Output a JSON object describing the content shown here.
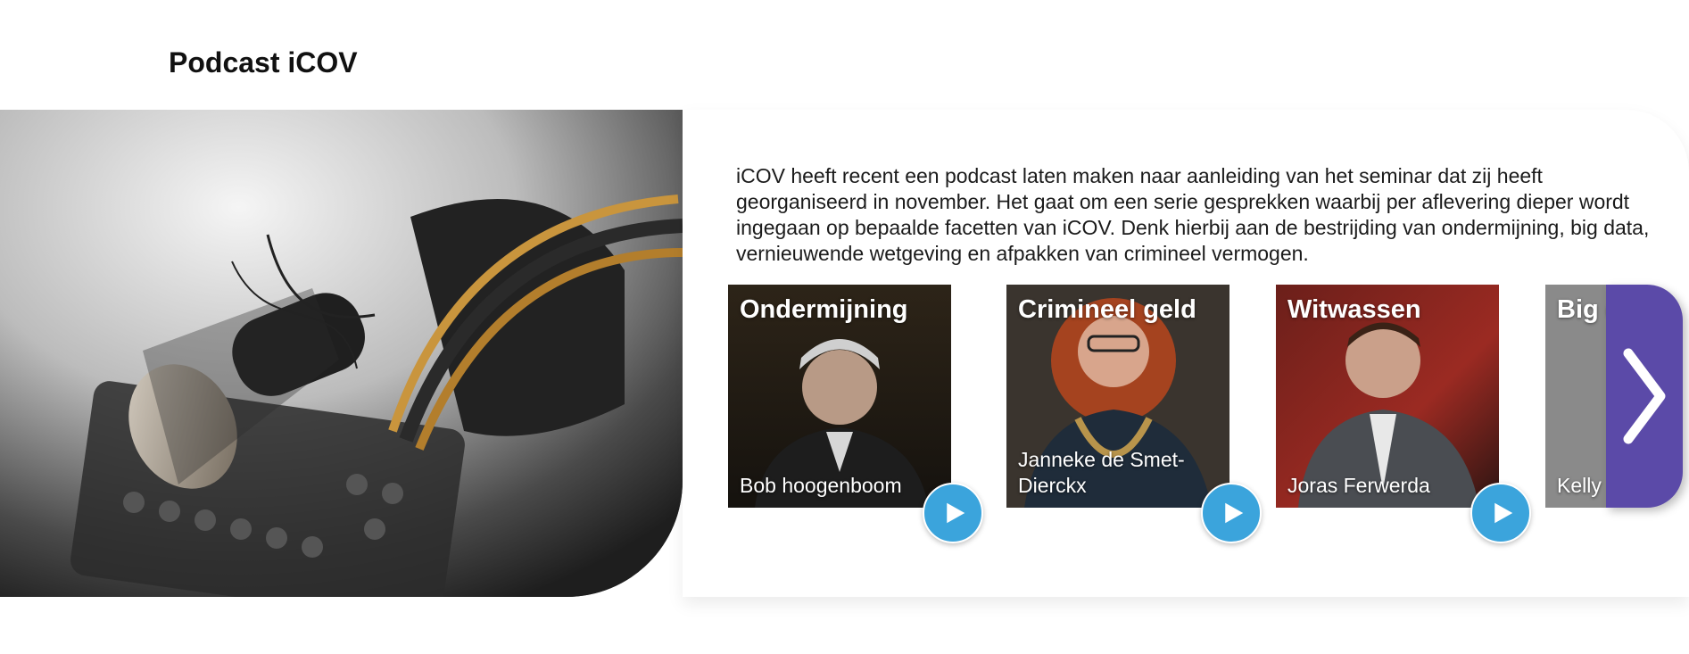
{
  "page": {
    "title": "Podcast iCOV"
  },
  "intro": {
    "text": "iCOV heeft recent een podcast laten maken naar aanleiding van het seminar dat zij heeft georganiseerd in november. Het gaat om een serie gesprekken waarbij per aflevering dieper wordt ingegaan op bepaalde facetten van iCOV. Denk hierbij aan de bestrijding van ondermijning, big data, vernieuwende wetgeving en afpakken van crimineel vermogen."
  },
  "episodes": [
    {
      "title": "Ondermijning",
      "guest": "Bob hoogenboom",
      "icon": "play-icon"
    },
    {
      "title": "Crimineel geld",
      "guest": "Janneke de Smet-Dierckx",
      "icon": "play-icon"
    },
    {
      "title": "Witwassen",
      "guest": "Joras Ferwerda",
      "icon": "play-icon"
    },
    {
      "title": "Big d",
      "guest": "Kelly",
      "icon": "play-icon"
    }
  ],
  "carousel": {
    "next_icon": "chevron-right-icon"
  },
  "colors": {
    "play_button": "#3ba4dc",
    "next_button": "#5b4aa8",
    "title_text": "#111111"
  }
}
